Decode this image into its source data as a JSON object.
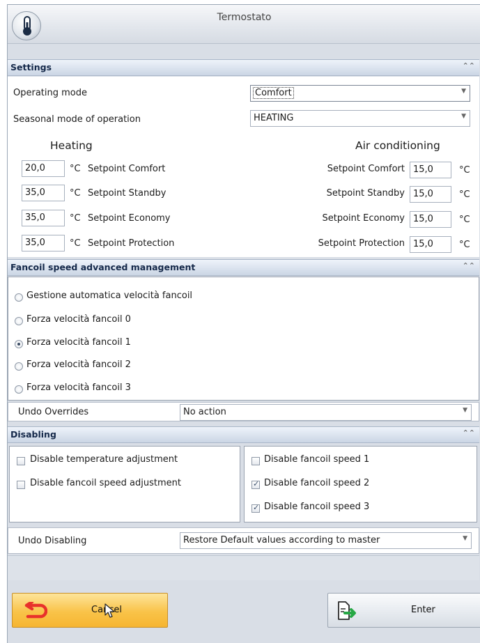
{
  "window": {
    "title": "Termostato",
    "icon": "thermometer-icon"
  },
  "settings": {
    "band_label": "Settings",
    "operating_mode_label": "Operating mode",
    "operating_mode_value": "Comfort",
    "seasonal_label": "Seasonal mode of operation",
    "seasonal_value": "HEATING",
    "heating_heading": "Heating",
    "aircon_heading": "Air conditioning",
    "unit": "°C",
    "heating_rows": [
      {
        "value": "20,0",
        "label": "Setpoint Comfort"
      },
      {
        "value": "35,0",
        "label": "Setpoint Standby"
      },
      {
        "value": "35,0",
        "label": "Setpoint Economy"
      },
      {
        "value": "35,0",
        "label": "Setpoint Protection"
      }
    ],
    "aircon_rows": [
      {
        "value": "15,0",
        "label": "Setpoint Comfort"
      },
      {
        "value": "15,0",
        "label": "Setpoint Standby"
      },
      {
        "value": "15,0",
        "label": "Setpoint Economy"
      },
      {
        "value": "15,0",
        "label": "Setpoint Protection"
      }
    ]
  },
  "fancoil": {
    "band_label": "Fancoil speed advanced management",
    "options": [
      {
        "label": "Gestione automatica velocità fancoil",
        "selected": false
      },
      {
        "label": "Forza velocità fancoil 0",
        "selected": false
      },
      {
        "label": "Forza velocità fancoil 1",
        "selected": true
      },
      {
        "label": "Forza velocità fancoil 2",
        "selected": false
      },
      {
        "label": "Forza velocità fancoil 3",
        "selected": false
      }
    ],
    "undo_overrides_label": "Undo Overrides",
    "undo_overrides_value": "No action"
  },
  "disabling": {
    "band_label": "Disabling",
    "left_checks": [
      {
        "label": "Disable temperature adjustment",
        "checked": false
      },
      {
        "label": "Disable fancoil speed adjustment",
        "checked": false
      }
    ],
    "right_checks": [
      {
        "label": "Disable fancoil speed 1",
        "checked": false
      },
      {
        "label": "Disable fancoil speed 2",
        "checked": true
      },
      {
        "label": "Disable fancoil speed 3",
        "checked": true
      }
    ],
    "undo_disabling_label": "Undo Disabling",
    "undo_disabling_value": "Restore Default values according to master"
  },
  "buttons": {
    "cancel": "Cancel",
    "enter": "Enter"
  },
  "colors": {
    "cancel_button": "#f9c349",
    "cancel_icon": "#e8312b",
    "enter_icon": "#27a845"
  }
}
